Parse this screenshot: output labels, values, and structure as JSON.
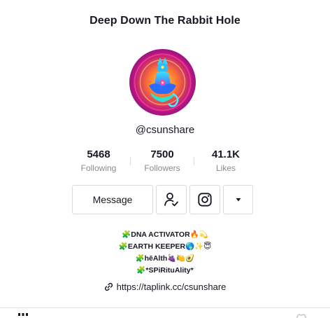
{
  "profile": {
    "title": "Deep Down The Rabbit Hole",
    "handle": "@csunshare"
  },
  "stats": [
    {
      "value": "5468",
      "label": "Following"
    },
    {
      "value": "7500",
      "label": "Followers"
    },
    {
      "value": "41.1K",
      "label": "Likes"
    }
  ],
  "actions": {
    "message_label": "Message"
  },
  "bio": {
    "line1": "🧩DNA ACTIVATOR🔥💫",
    "line2": "🧩EARTH KEEPER🌎✨😇",
    "line3": "🧩hēAlth🍇🍋🥑",
    "line4": "🧩*SPiRituAlity*"
  },
  "link": {
    "url": "https://taplink.cc/csunshare"
  },
  "icons": {
    "follow": "person-check-icon",
    "instagram": "instagram-icon",
    "more": "caret-down-icon",
    "link": "link-icon"
  },
  "colors": {
    "text": "#161823",
    "muted": "#8a8b91",
    "border": "#d9dadc"
  }
}
